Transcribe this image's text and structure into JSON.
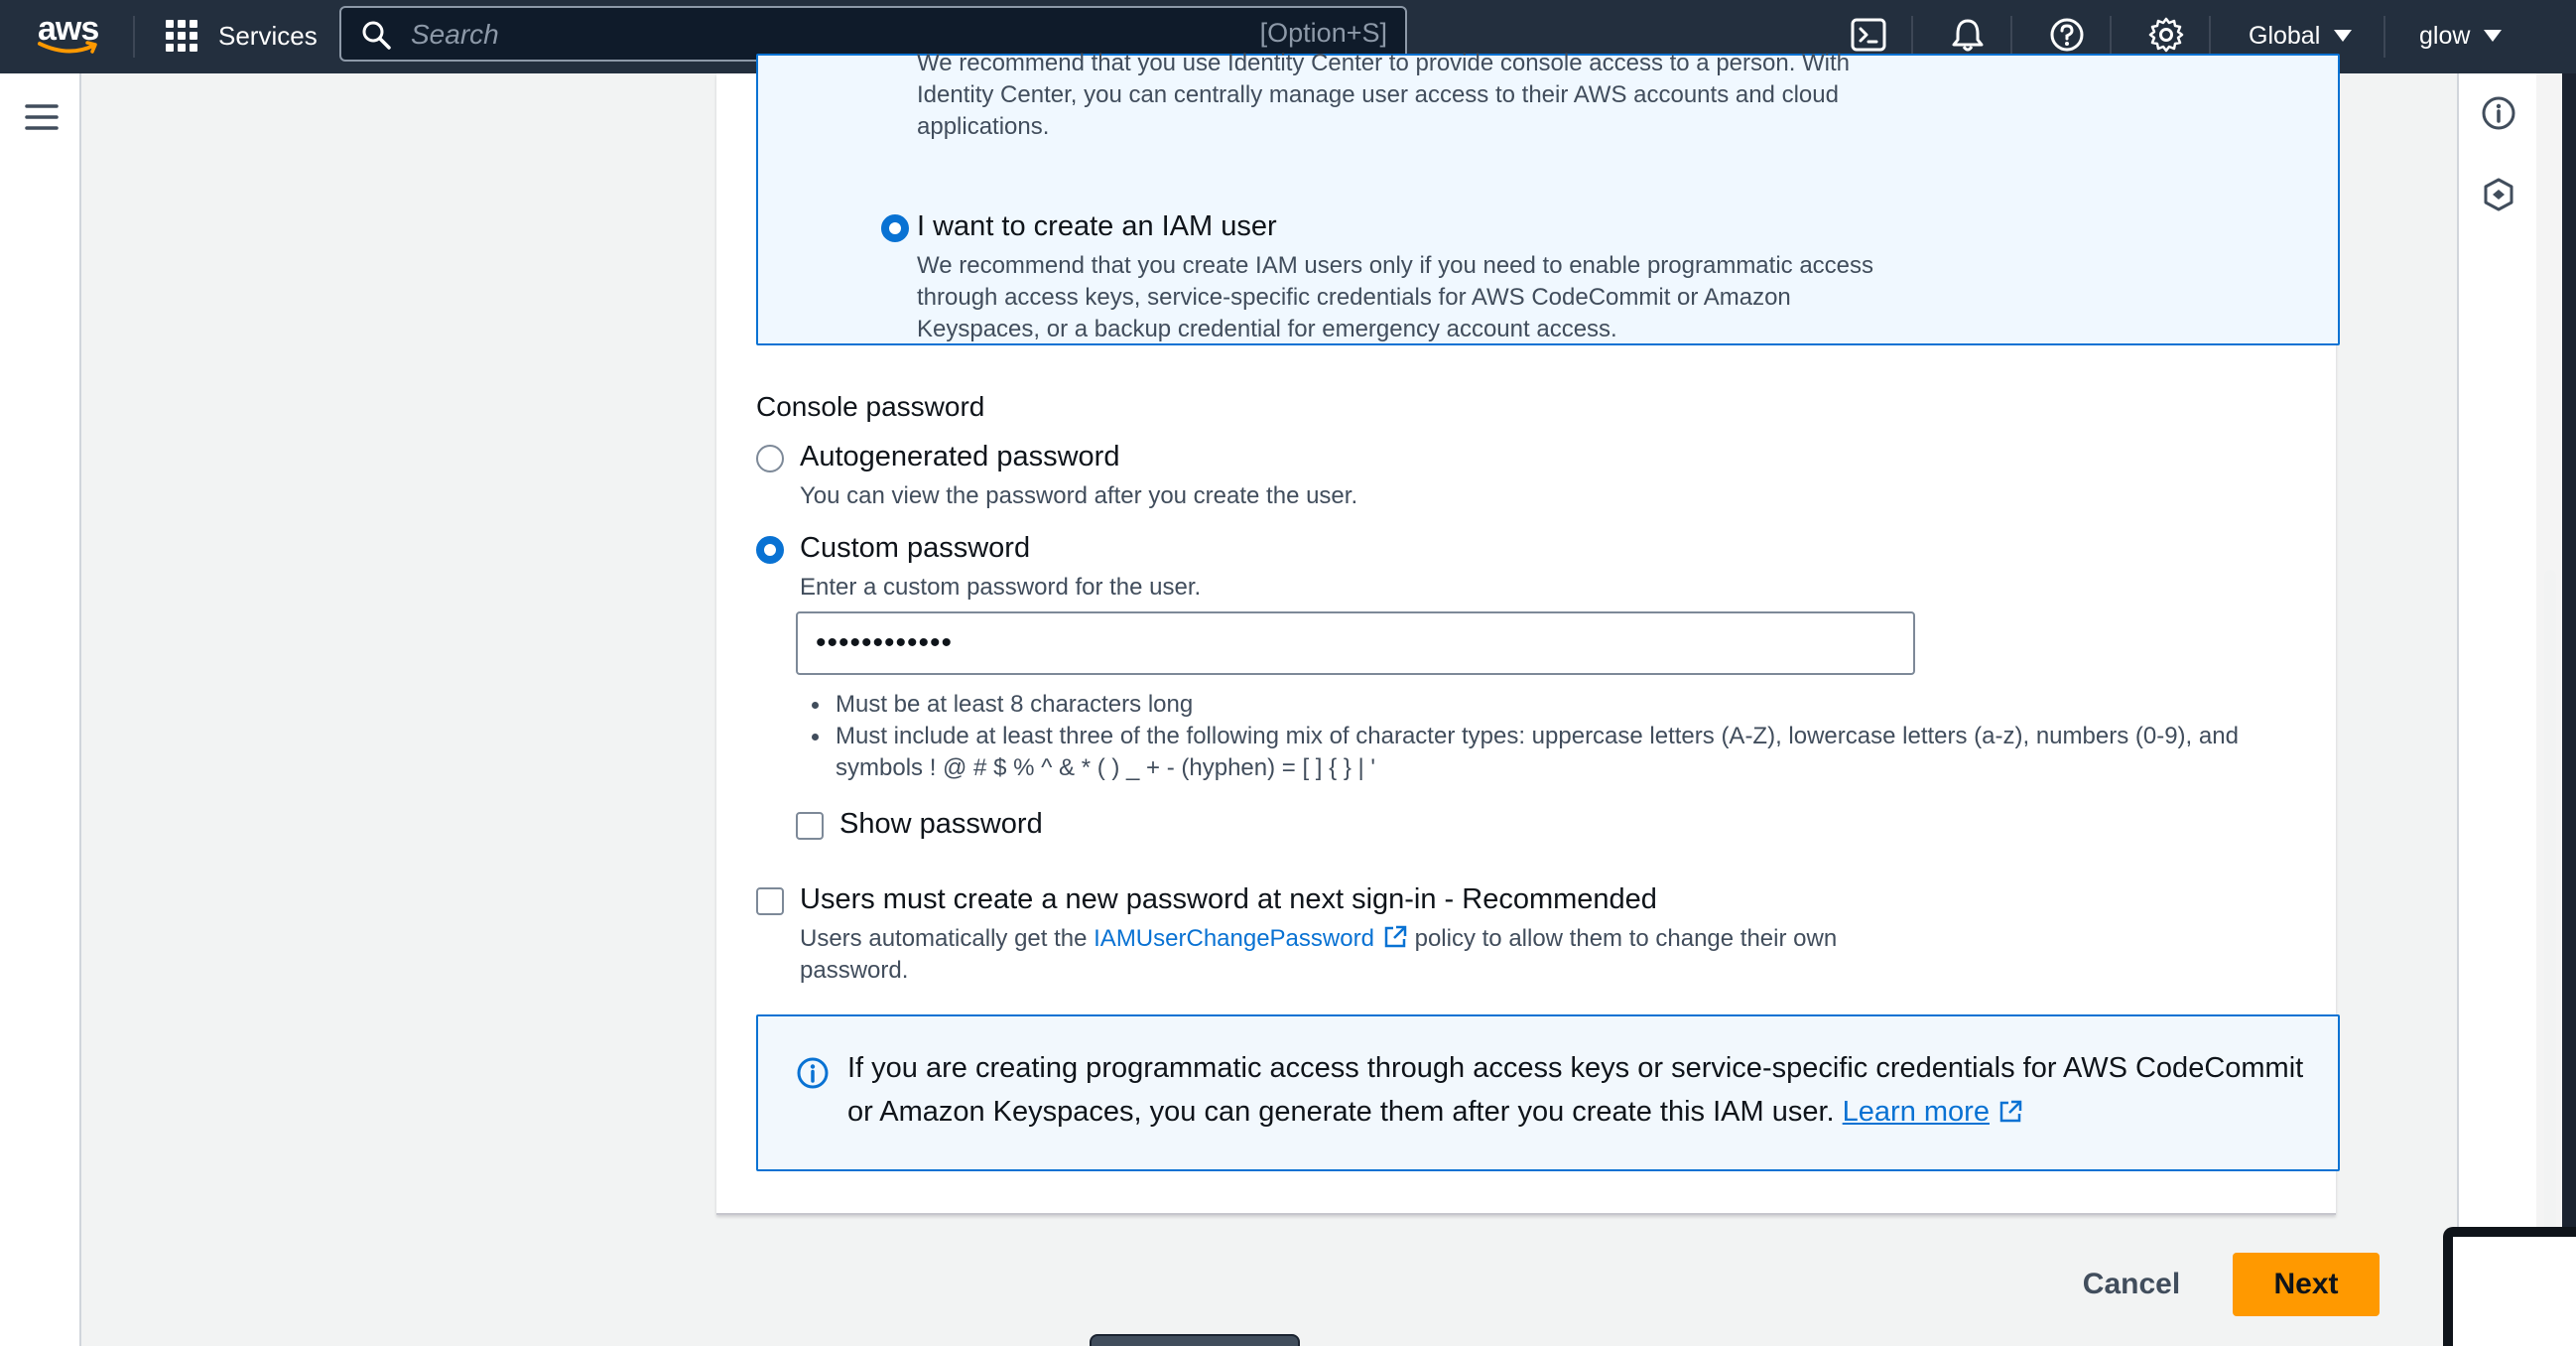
{
  "nav": {
    "logo_text": "aws",
    "services_label": "Services",
    "search_placeholder": "Search",
    "search_shortcut": "[Option+S]",
    "region_label": "Global",
    "user_label": "glow"
  },
  "identity_options": {
    "identity_center_desc": "We recommend that you use Identity Center to provide console access to a person. With Identity Center, you can centrally manage user access to their AWS accounts and cloud applications.",
    "iam_user_label": "I want to create an IAM user",
    "iam_user_desc": "We recommend that you create IAM users only if you need to enable programmatic access through access keys, service-specific credentials for AWS CodeCommit or Amazon Keyspaces, or a backup credential for emergency account access."
  },
  "console_password": {
    "section_label": "Console password",
    "autogenerated_label": "Autogenerated password",
    "autogenerated_desc": "You can view the password after you create the user.",
    "custom_label": "Custom password",
    "custom_desc": "Enter a custom password for the user.",
    "password_value": "••••••••••••",
    "rules": [
      "Must be at least 8 characters long",
      "Must include at least three of the following mix of character types: uppercase letters (A-Z), lowercase letters (a-z), numbers (0-9), and symbols ! @ # $ % ^ & * ( ) _ + - (hyphen) = [ ] { } | '"
    ],
    "show_password_label": "Show password",
    "selected": "custom"
  },
  "reset_password": {
    "label": "Users must create a new password at next sign-in - Recommended",
    "desc_prefix": "Users automatically get the",
    "policy_link": "IAMUserChangePassword",
    "desc_suffix": "policy to allow them to change their own password."
  },
  "info_alert": {
    "text": "If you are creating programmatic access through access keys or service-specific credentials for AWS CodeCommit or Amazon Keyspaces, you can generate them after you create this IAM user.",
    "link": "Learn more"
  },
  "actions": {
    "cancel_label": "Cancel",
    "next_label": "Next"
  },
  "colors": {
    "nav_bg": "#232f3e",
    "accent_blue": "#0972d3",
    "primary_orange": "#ff9900",
    "page_bg": "#f2f3f3"
  },
  "icons": [
    "aws-logo",
    "services-grid-icon",
    "search-icon",
    "cloudshell-icon",
    "notifications-icon",
    "help-icon",
    "settings-icon",
    "caret-down-icon",
    "menu-icon",
    "info-icon",
    "security-icon",
    "external-link-icon"
  ]
}
